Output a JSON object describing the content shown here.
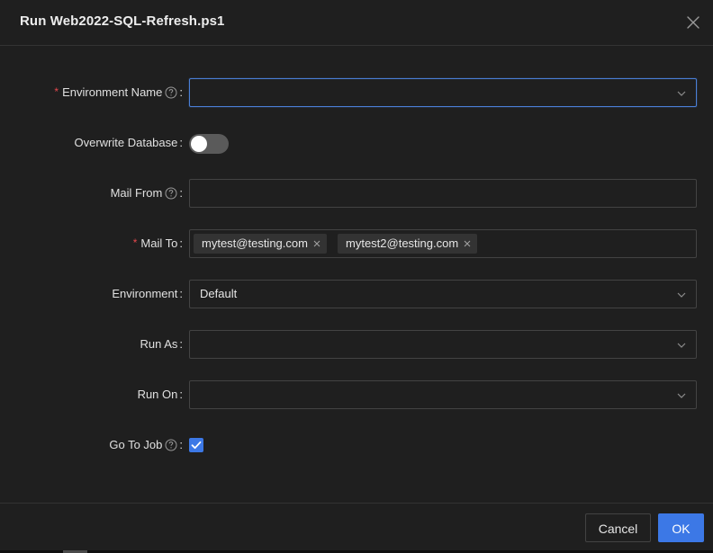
{
  "dialog": {
    "title": "Run Web2022-SQL-Refresh.ps1"
  },
  "fields": {
    "environment_name": {
      "label": "Environment Name",
      "required_mark": "*",
      "value": ""
    },
    "overwrite_database": {
      "label": "Overwrite Database",
      "enabled": false
    },
    "mail_from": {
      "label": "Mail From",
      "value": ""
    },
    "mail_to": {
      "label": "Mail To",
      "required_mark": "*",
      "tags": [
        "mytest@testing.com",
        "mytest2@testing.com"
      ]
    },
    "environment": {
      "label": "Environment",
      "value": "Default"
    },
    "run_as": {
      "label": "Run As",
      "value": ""
    },
    "run_on": {
      "label": "Run On",
      "value": ""
    },
    "go_to_job": {
      "label": "Go To Job",
      "checked": true
    }
  },
  "colon": ":",
  "footer": {
    "cancel_label": "Cancel",
    "ok_label": "OK"
  },
  "colors": {
    "background": "#1f1f1f",
    "accent": "#3c78e6",
    "required": "#e5484d",
    "border": "#434343"
  },
  "icons": {
    "close": "close-icon",
    "help": "question-circle-icon",
    "chevron": "chevron-down-icon",
    "tag_close": "close-icon",
    "check": "check-icon"
  }
}
